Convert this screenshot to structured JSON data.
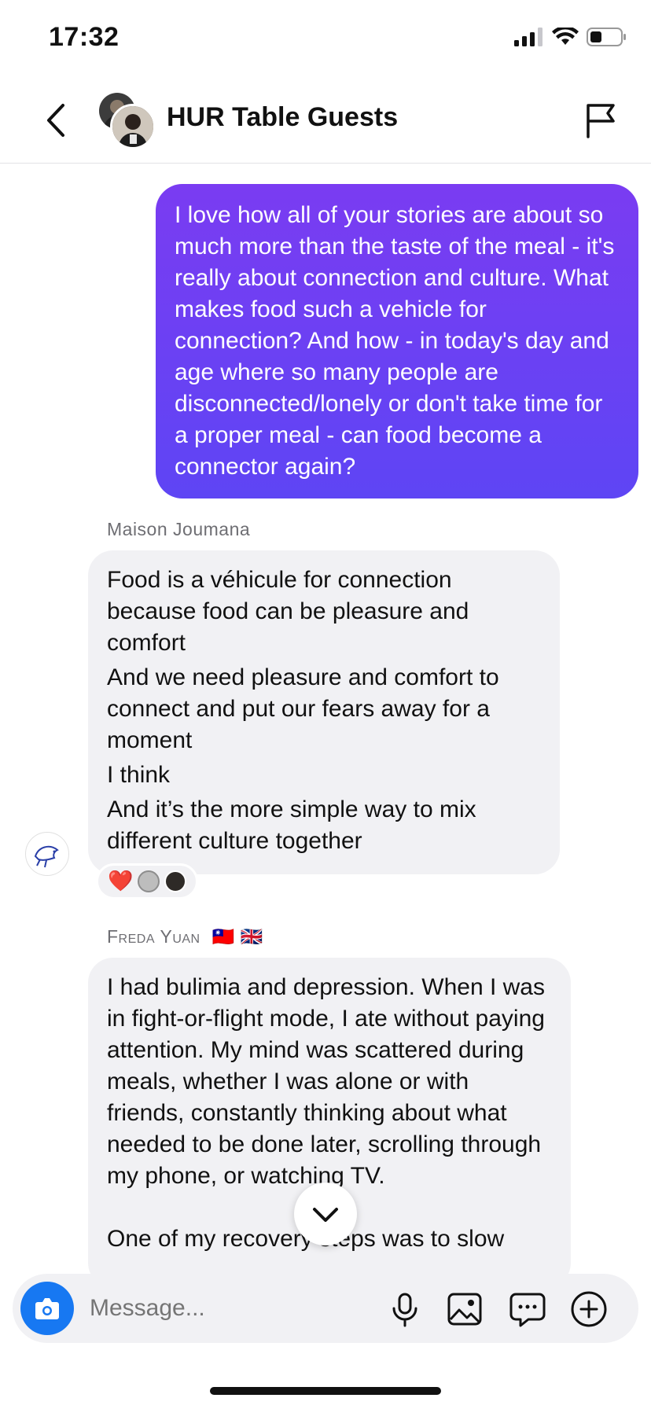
{
  "status_bar": {
    "time": "17:32"
  },
  "header": {
    "title": "HUR Table Guests"
  },
  "outgoing_message": {
    "text": "I love how all of your stories are about so much more than the taste of the meal - it's really about connection and culture.  What makes food such a vehicle for connection? And how - in today's day and age where so many people are disconnected/lonely or don't take time for a proper meal - can food become a connector again?"
  },
  "messages": [
    {
      "sender": "Maison Joumana",
      "lines": [
        "Food is a véhicule for connection because food  can be pleasure and comfort",
        "And we need pleasure and comfort to connect and put our fears away for a moment",
        "I think",
        "And it’s the more simple way  to mix different culture together"
      ],
      "reactions": {
        "emoji": "❤️"
      }
    },
    {
      "sender": "Freda Yuan",
      "sender_flags": "🇹🇼 🇬🇧",
      "text": "I had bulimia and depression. When I was in fight-or-flight mode, I ate without paying attention. My mind was scattered during meals, whether I was alone or with friends, constantly thinking about what needed to be done later, scrolling through my phone, or watching TV.",
      "text_cut": "One of my recovery steps was to slow"
    }
  ],
  "composer": {
    "placeholder": "Message..."
  },
  "colors": {
    "accent": "#1778f2",
    "outgoing_bubble": "#6b40f3",
    "incoming_bubble": "#f1f1f4"
  },
  "icons": [
    "back-chevron-icon",
    "flag-icon",
    "camera-icon",
    "microphone-icon",
    "image-icon",
    "sticker-icon",
    "plus-icon",
    "chevron-down-icon"
  ]
}
